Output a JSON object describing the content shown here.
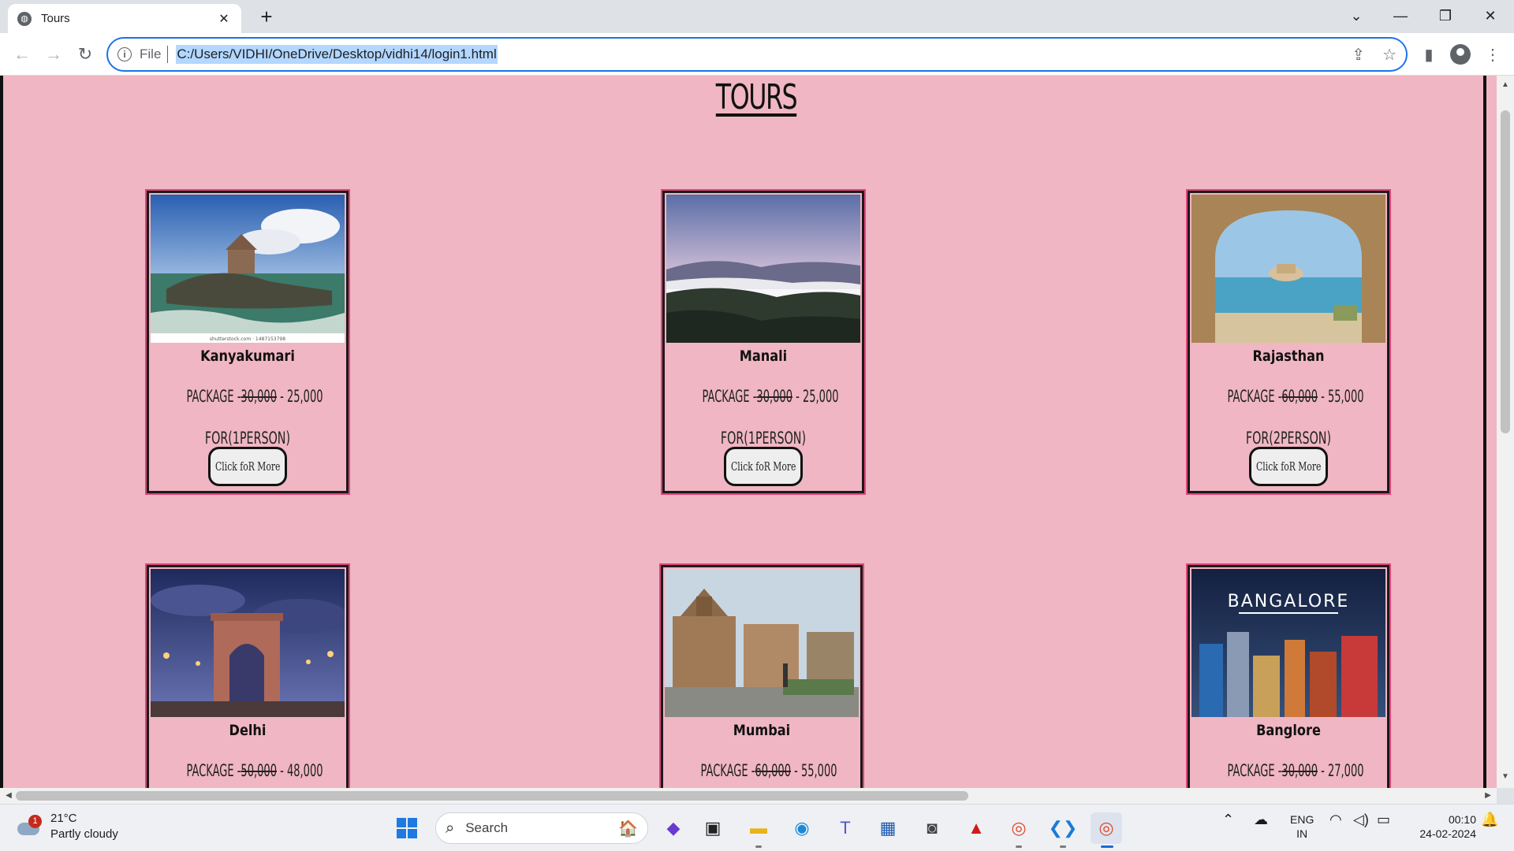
{
  "browser": {
    "tab_title": "Tours",
    "tab_favicon": "globe-icon",
    "new_tab_label": "+",
    "scheme_label": "File",
    "url": "C:/Users/VIDHI/OneDrive/Desktop/vidhi14/login1.html"
  },
  "page": {
    "title": "TOURS",
    "button_label": "Click foR More",
    "package_label": "PACKAGE -",
    "tours": [
      {
        "name": "Kanyakumari",
        "old_price": "30,000",
        "new_price": "25,000",
        "for": "FOR(1PERSON)",
        "photo_caption": "shutterstock.com · 1487153798"
      },
      {
        "name": "Manali",
        "old_price": "30,000",
        "new_price": "25,000",
        "for": "FOR(1PERSON)"
      },
      {
        "name": "Rajasthan",
        "old_price": "60,000",
        "new_price": "55,000",
        "for": "FOR(2PERSON)"
      },
      {
        "name": "Delhi",
        "old_price": "50,000",
        "new_price": "48,000"
      },
      {
        "name": "Mumbai",
        "old_price": "60,000",
        "new_price": "55,000"
      },
      {
        "name": "Banglore",
        "old_price": "30,000",
        "new_price": "27,000",
        "photo_caption": "BANGALORE"
      }
    ]
  },
  "taskbar": {
    "temperature": "21°C",
    "weather": "Partly cloudy",
    "weather_badge": "1",
    "search_label": "Search",
    "lang_line1": "ENG",
    "lang_line2": "IN",
    "time": "00:10",
    "date": "24-02-2024"
  }
}
